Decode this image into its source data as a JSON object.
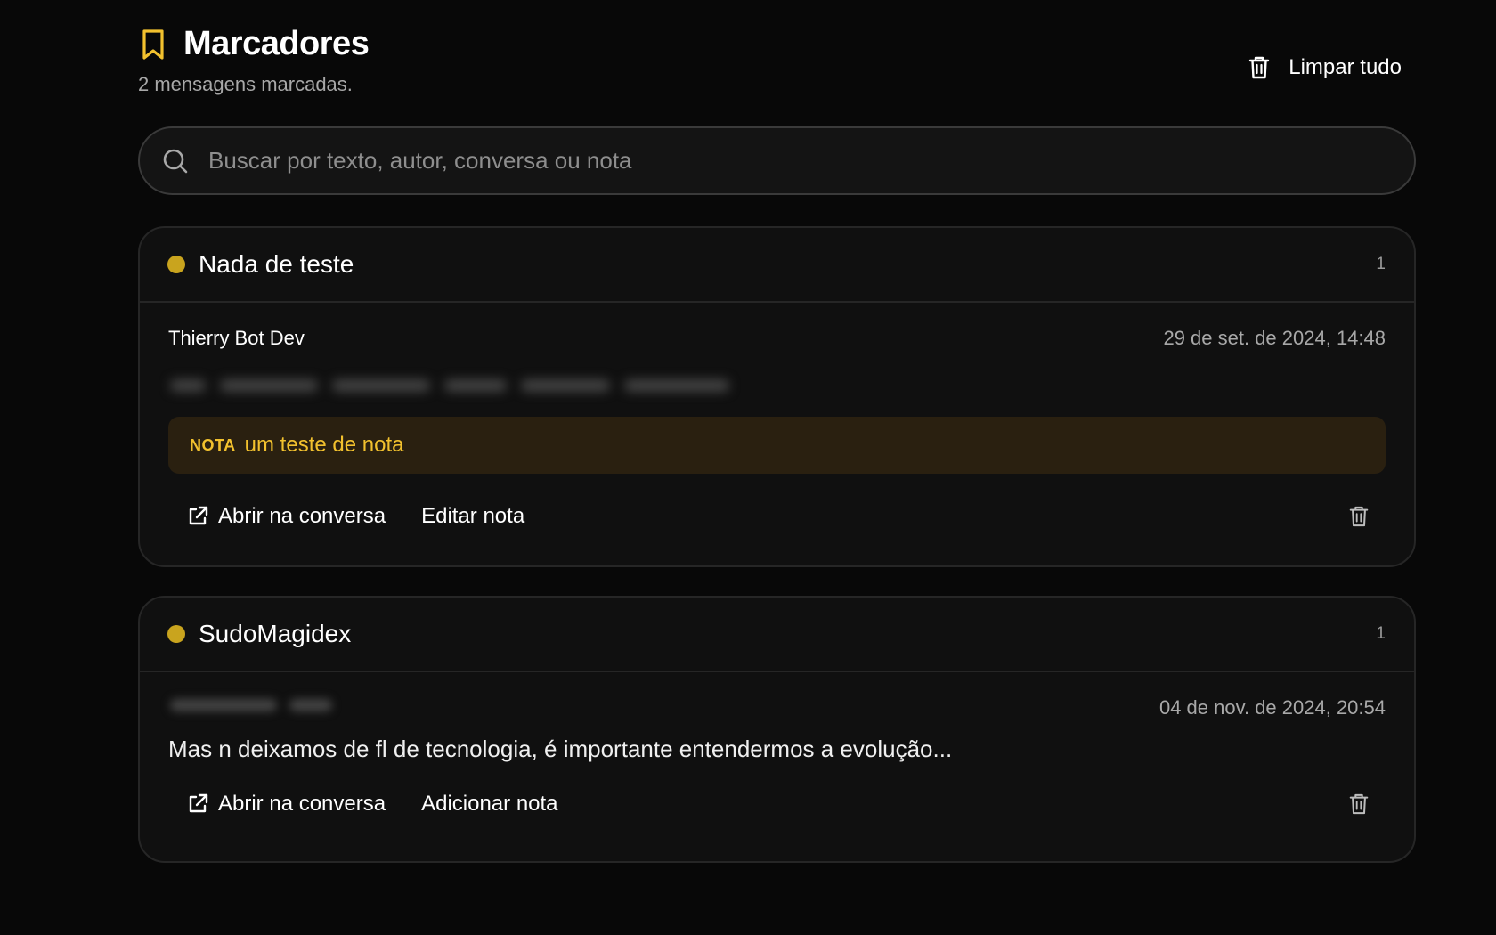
{
  "header": {
    "title": "Marcadores",
    "subtitle": "2 mensagens marcadas.",
    "clear_all_label": "Limpar tudo",
    "accent_color": "#f2c12e"
  },
  "search": {
    "placeholder": "Buscar por texto, autor, conversa ou nota",
    "value": ""
  },
  "groups": [
    {
      "name": "Nada de teste",
      "count": "1",
      "dot_color": "#c9a41e",
      "items": [
        {
          "author": "Thierry Bot Dev",
          "timestamp": "29 de set. de 2024, 14:48",
          "message": "",
          "message_blurred": true,
          "note_tag": "NOTA",
          "note_text": "um teste de nota",
          "open_label": "Abrir na conversa",
          "note_action_label": "Editar nota"
        }
      ]
    },
    {
      "name": "SudoMagidex",
      "count": "1",
      "dot_color": "#c9a41e",
      "items": [
        {
          "author": "",
          "author_blurred": true,
          "timestamp": "04 de nov. de 2024, 20:54",
          "message": "Mas n deixamos de fl de tecnologia, é importante entendermos a evolução...",
          "open_label": "Abrir na conversa",
          "note_action_label": "Adicionar nota"
        }
      ]
    }
  ]
}
